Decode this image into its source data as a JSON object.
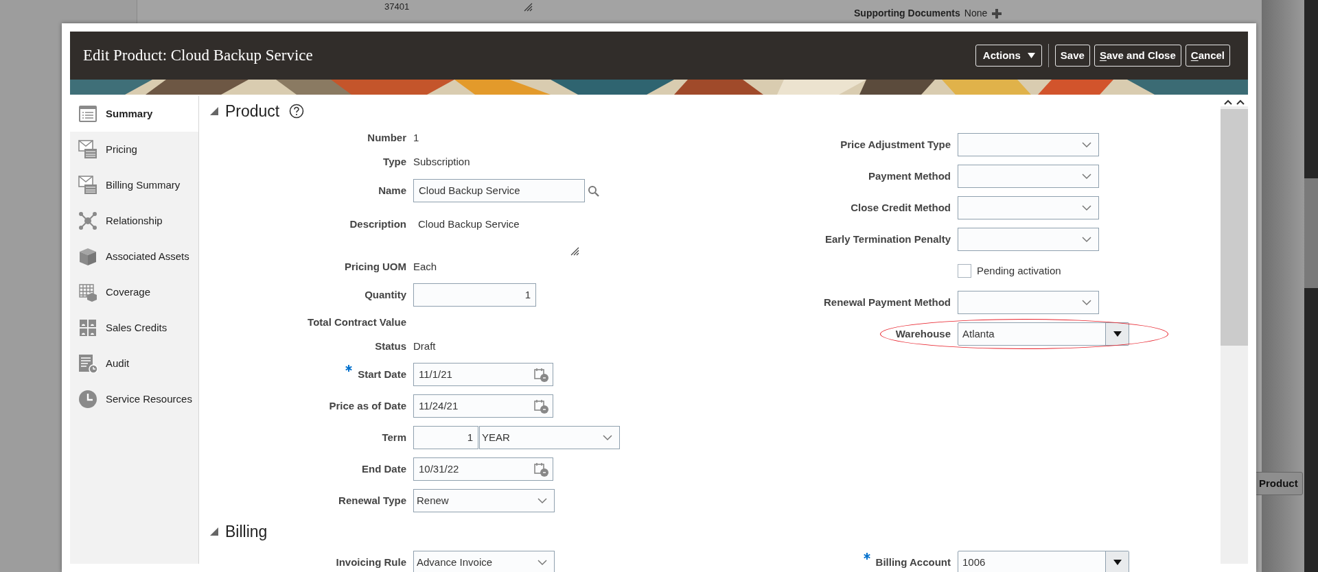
{
  "background": {
    "record_number": "37401",
    "supporting_documents": {
      "label": "Supporting Documents",
      "value": "None"
    },
    "product_button": "Product"
  },
  "dialog": {
    "title": "Edit Product: Cloud Backup Service",
    "buttons": [
      {
        "label": "Actions",
        "kind": "menu",
        "mnemonic": false
      },
      {
        "label": "Save",
        "kind": "plain",
        "mnemonic": false
      },
      {
        "label": "Save and Close",
        "kind": "plain",
        "mnemonic": true
      },
      {
        "label": "Cancel",
        "kind": "plain",
        "mnemonic": true
      }
    ],
    "sidebar": {
      "items": [
        {
          "label": "Summary",
          "selected": true
        },
        {
          "label": "Pricing",
          "selected": false
        },
        {
          "label": "Billing Summary",
          "selected": false
        },
        {
          "label": "Relationship",
          "selected": false
        },
        {
          "label": "Associated Assets",
          "selected": false
        },
        {
          "label": "Coverage",
          "selected": false
        },
        {
          "label": "Sales Credits",
          "selected": false
        },
        {
          "label": "Audit",
          "selected": false
        },
        {
          "label": "Service Resources",
          "selected": false
        }
      ]
    },
    "sections": [
      {
        "title": "Product",
        "expanded": true,
        "help": true,
        "left_fields": [
          {
            "label": "Number",
            "kind": "text",
            "value": "1"
          },
          {
            "label": "Type",
            "kind": "text",
            "value": "Subscription"
          },
          {
            "label": "Name",
            "kind": "lookup",
            "value": "Cloud Backup Service"
          },
          {
            "label": "Description",
            "kind": "textarea",
            "value": "Cloud Backup Service"
          },
          {
            "label": "Pricing UOM",
            "kind": "text",
            "value": "Each"
          },
          {
            "label": "Quantity",
            "kind": "number",
            "value": "1"
          },
          {
            "label": "Total Contract Value",
            "kind": "text"
          },
          {
            "label": "Status",
            "kind": "text",
            "value": "Draft"
          },
          {
            "label": "Start Date",
            "kind": "date",
            "value": "11/1/21",
            "required": true
          },
          {
            "label": "Price as of Date",
            "kind": "date",
            "value": "11/24/21"
          },
          {
            "label": "Term",
            "kind": "term",
            "value": "1",
            "unit": "YEAR"
          },
          {
            "label": "End Date",
            "kind": "date",
            "value": "10/31/22"
          },
          {
            "label": "Renewal Type",
            "kind": "select",
            "value": "Renew"
          }
        ],
        "right_fields": [
          {
            "label": "Price Adjustment Type",
            "kind": "select"
          },
          {
            "label": "Payment Method",
            "kind": "select"
          },
          {
            "label": "Close Credit Method",
            "kind": "select"
          },
          {
            "label": "Early Termination Penalty",
            "kind": "select"
          },
          {
            "label": "Pending activation",
            "kind": "checkbox",
            "checked": false
          },
          {
            "label": "Renewal Payment Method",
            "kind": "select"
          },
          {
            "label": "Warehouse",
            "kind": "combo",
            "value": "Atlanta",
            "highlighted": true
          }
        ]
      },
      {
        "title": "Billing",
        "expanded": true,
        "help": false,
        "left_fields": [
          {
            "label": "Invoicing Rule",
            "kind": "select",
            "value": "Advance Invoice"
          }
        ],
        "right_fields": [
          {
            "label": "Billing Account",
            "kind": "combo",
            "value": "1006",
            "required": true
          }
        ]
      }
    ]
  }
}
